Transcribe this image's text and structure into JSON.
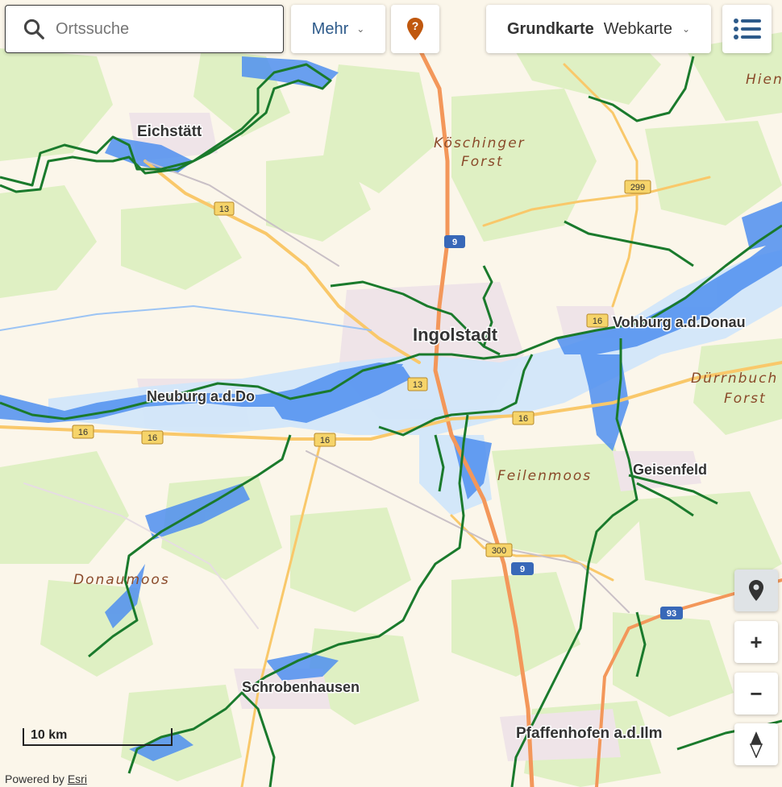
{
  "search": {
    "placeholder": "Ortssuche"
  },
  "toolbar": {
    "more_label": "Mehr",
    "basemap_prefix": "Grundkarte",
    "basemap_value": "Webkarte"
  },
  "map": {
    "places": {
      "eichstaett": "Eichstätt",
      "ingolstadt": "Ingolstadt",
      "neuburg": "Neuburg a.d.Do",
      "vohburg": "Vohburg a.d.Donau",
      "geisenfeld": "Geisenfeld",
      "schrobenhausen": "Schrobenhausen",
      "pfaffenhofen": "Pfaffenhofen a.d.Ilm",
      "hiendorf": "Hien"
    },
    "forests": {
      "koeschinger_1": "Köschinger",
      "koeschinger_2": "Forst",
      "duernbuch_1": "Dürrnbuch",
      "duernbuch_2": "Forst",
      "feilenmoos": "Feilenmoos",
      "donaumoos": "Donaumoos"
    },
    "road_shields": {
      "r13_north": "13",
      "r13_city": "13",
      "r9_north": "9",
      "r9_south": "9",
      "r16_west": "16",
      "r16_mid": "16",
      "r16_east": "16",
      "r16_far": "16",
      "r299": "299",
      "r300": "300",
      "r93": "93",
      "r16_vohburg": "16"
    },
    "colors": {
      "land": "#fbf6ea",
      "forest": "#dff0c3",
      "flood": "#4f8ff0",
      "flood_light": "#cfe6fb",
      "stream": "#1a7a2c",
      "motorway": "#f3975a",
      "major_road": "#f9c86a"
    }
  },
  "scale": {
    "label": "10 km"
  },
  "attribution": {
    "prefix": "Powered by ",
    "link": "Esri"
  }
}
